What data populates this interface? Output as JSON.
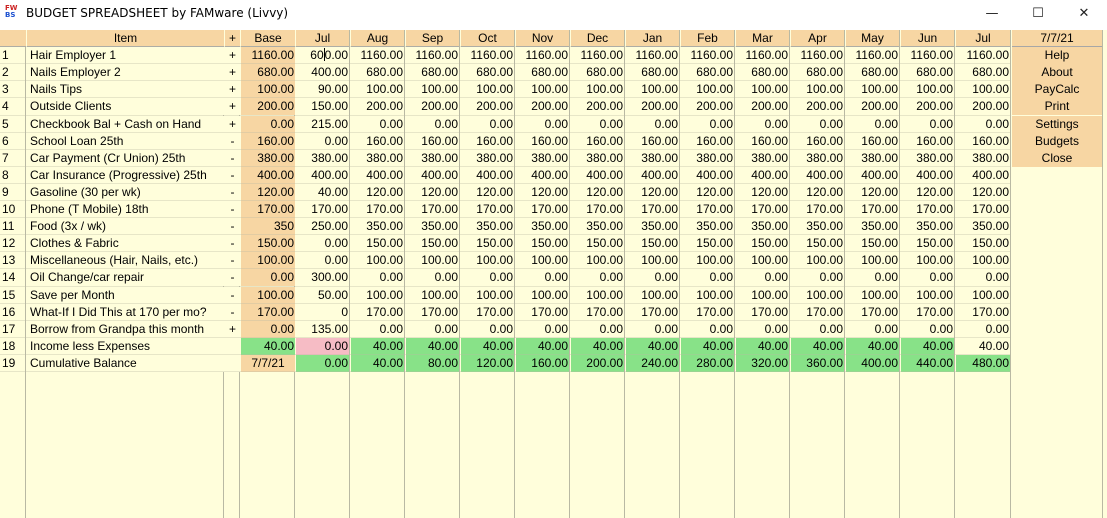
{
  "window": {
    "title": "BUDGET SPREADSHEET by FAMware (Livvy)",
    "icon_text_top": "FW",
    "icon_text_bottom": "BS",
    "minimize_glyph": "—",
    "maximize_glyph": "☐",
    "close_glyph": "✕"
  },
  "sheet": {
    "headers": {
      "item": "Item",
      "sign": "+",
      "base": "Base"
    },
    "months": [
      "Jul",
      "Aug",
      "Sep",
      "Oct",
      "Nov",
      "Dec",
      "Jan",
      "Feb",
      "Mar",
      "Apr",
      "May",
      "Jun",
      "Jul"
    ],
    "rows": [
      {
        "n": "1",
        "item": "Hair Employer 1",
        "sign": "+",
        "base": "1160.00",
        "values": [
          "600.00",
          "1160.00",
          "1160.00",
          "1160.00",
          "1160.00",
          "1160.00",
          "1160.00",
          "1160.00",
          "1160.00",
          "1160.00",
          "1160.00",
          "1160.00",
          "1160.00"
        ]
      },
      {
        "n": "2",
        "item": "Nails Employer 2",
        "sign": "+",
        "base": "680.00",
        "values": [
          "400.00",
          "680.00",
          "680.00",
          "680.00",
          "680.00",
          "680.00",
          "680.00",
          "680.00",
          "680.00",
          "680.00",
          "680.00",
          "680.00",
          "680.00"
        ]
      },
      {
        "n": "3",
        "item": "Nails Tips",
        "sign": "+",
        "base": "100.00",
        "values": [
          "90.00",
          "100.00",
          "100.00",
          "100.00",
          "100.00",
          "100.00",
          "100.00",
          "100.00",
          "100.00",
          "100.00",
          "100.00",
          "100.00",
          "100.00"
        ]
      },
      {
        "n": "4",
        "item": "Outside Clients",
        "sign": "+",
        "base": "200.00",
        "values": [
          "150.00",
          "200.00",
          "200.00",
          "200.00",
          "200.00",
          "200.00",
          "200.00",
          "200.00",
          "200.00",
          "200.00",
          "200.00",
          "200.00",
          "200.00"
        ]
      },
      {
        "n": "5",
        "item": "Checkbook Bal + Cash on Hand",
        "sign": "+",
        "base": "0.00",
        "values": [
          "215.00",
          "0.00",
          "0.00",
          "0.00",
          "0.00",
          "0.00",
          "0.00",
          "0.00",
          "0.00",
          "0.00",
          "0.00",
          "0.00",
          "0.00"
        ]
      },
      {
        "n": "6",
        "item": "School Loan 25th",
        "sign": "-",
        "base": "160.00",
        "values": [
          "0.00",
          "160.00",
          "160.00",
          "160.00",
          "160.00",
          "160.00",
          "160.00",
          "160.00",
          "160.00",
          "160.00",
          "160.00",
          "160.00",
          "160.00"
        ]
      },
      {
        "n": "7",
        "item": "Car Payment (Cr Union) 25th",
        "sign": "-",
        "base": "380.00",
        "values": [
          "380.00",
          "380.00",
          "380.00",
          "380.00",
          "380.00",
          "380.00",
          "380.00",
          "380.00",
          "380.00",
          "380.00",
          "380.00",
          "380.00",
          "380.00"
        ]
      },
      {
        "n": "8",
        "item": "Car Insurance (Progressive) 25th",
        "sign": "-",
        "base": "400.00",
        "values": [
          "400.00",
          "400.00",
          "400.00",
          "400.00",
          "400.00",
          "400.00",
          "400.00",
          "400.00",
          "400.00",
          "400.00",
          "400.00",
          "400.00",
          "400.00"
        ]
      },
      {
        "n": "9",
        "item": "Gasoline (30 per wk)",
        "sign": "-",
        "base": "120.00",
        "values": [
          "40.00",
          "120.00",
          "120.00",
          "120.00",
          "120.00",
          "120.00",
          "120.00",
          "120.00",
          "120.00",
          "120.00",
          "120.00",
          "120.00",
          "120.00"
        ]
      },
      {
        "n": "10",
        "item": "Phone (T Mobile) 18th",
        "sign": "-",
        "base": "170.00",
        "values": [
          "170.00",
          "170.00",
          "170.00",
          "170.00",
          "170.00",
          "170.00",
          "170.00",
          "170.00",
          "170.00",
          "170.00",
          "170.00",
          "170.00",
          "170.00"
        ]
      },
      {
        "n": "11",
        "item": "Food (3x / wk)",
        "sign": "-",
        "base": "350",
        "values": [
          "250.00",
          "350.00",
          "350.00",
          "350.00",
          "350.00",
          "350.00",
          "350.00",
          "350.00",
          "350.00",
          "350.00",
          "350.00",
          "350.00",
          "350.00"
        ]
      },
      {
        "n": "12",
        "item": "Clothes & Fabric",
        "sign": "-",
        "base": "150.00",
        "values": [
          "0.00",
          "150.00",
          "150.00",
          "150.00",
          "150.00",
          "150.00",
          "150.00",
          "150.00",
          "150.00",
          "150.00",
          "150.00",
          "150.00",
          "150.00"
        ]
      },
      {
        "n": "13",
        "item": "Miscellaneous (Hair, Nails, etc.)",
        "sign": "-",
        "base": "100.00",
        "values": [
          "0.00",
          "100.00",
          "100.00",
          "100.00",
          "100.00",
          "100.00",
          "100.00",
          "100.00",
          "100.00",
          "100.00",
          "100.00",
          "100.00",
          "100.00"
        ]
      },
      {
        "n": "14",
        "item": "Oil Change/car repair",
        "sign": "-",
        "base": "0.00",
        "values": [
          "300.00",
          "0.00",
          "0.00",
          "0.00",
          "0.00",
          "0.00",
          "0.00",
          "0.00",
          "0.00",
          "0.00",
          "0.00",
          "0.00",
          "0.00"
        ]
      },
      {
        "n": "15",
        "item": "Save per Month",
        "sign": "-",
        "base": "100.00",
        "values": [
          "50.00",
          "100.00",
          "100.00",
          "100.00",
          "100.00",
          "100.00",
          "100.00",
          "100.00",
          "100.00",
          "100.00",
          "100.00",
          "100.00",
          "100.00"
        ]
      },
      {
        "n": "16",
        "item": "What-If I Did This at 170 per mo?",
        "sign": "-",
        "base": "170.00",
        "values": [
          "0",
          "170.00",
          "170.00",
          "170.00",
          "170.00",
          "170.00",
          "170.00",
          "170.00",
          "170.00",
          "170.00",
          "170.00",
          "170.00",
          "170.00"
        ]
      },
      {
        "n": "17",
        "item": "Borrow from Grandpa this month",
        "sign": "+",
        "base": "0.00",
        "values": [
          "135.00",
          "0.00",
          "0.00",
          "0.00",
          "0.00",
          "0.00",
          "0.00",
          "0.00",
          "0.00",
          "0.00",
          "0.00",
          "0.00",
          "0.00"
        ]
      }
    ],
    "summary": [
      {
        "n": "18",
        "item": "Income less Expenses",
        "sign": "",
        "base": "40.00",
        "values": [
          "0.00",
          "40.00",
          "40.00",
          "40.00",
          "40.00",
          "40.00",
          "40.00",
          "40.00",
          "40.00",
          "40.00",
          "40.00",
          "40.00",
          "40.00"
        ]
      },
      {
        "n": "19",
        "item": "Cumulative Balance",
        "sign": "",
        "base": "7/7/21",
        "values": [
          "0.00",
          "40.00",
          "80.00",
          "120.00",
          "160.00",
          "200.00",
          "240.00",
          "280.00",
          "320.00",
          "360.00",
          "400.00",
          "440.00",
          "480.00"
        ]
      }
    ],
    "total_rows": 28
  },
  "side": {
    "date": "7/7/21",
    "buttons": [
      "Help",
      "About",
      "PayCalc",
      "Print",
      "Settings",
      "Budgets",
      "Close"
    ]
  },
  "colors": {
    "header_bg": "#f7d6a3",
    "cell_bg": "#fffedb",
    "positive_green": "#88e288",
    "negative_pink": "#f6bcc5",
    "grid_line": "#b9b9a3"
  }
}
